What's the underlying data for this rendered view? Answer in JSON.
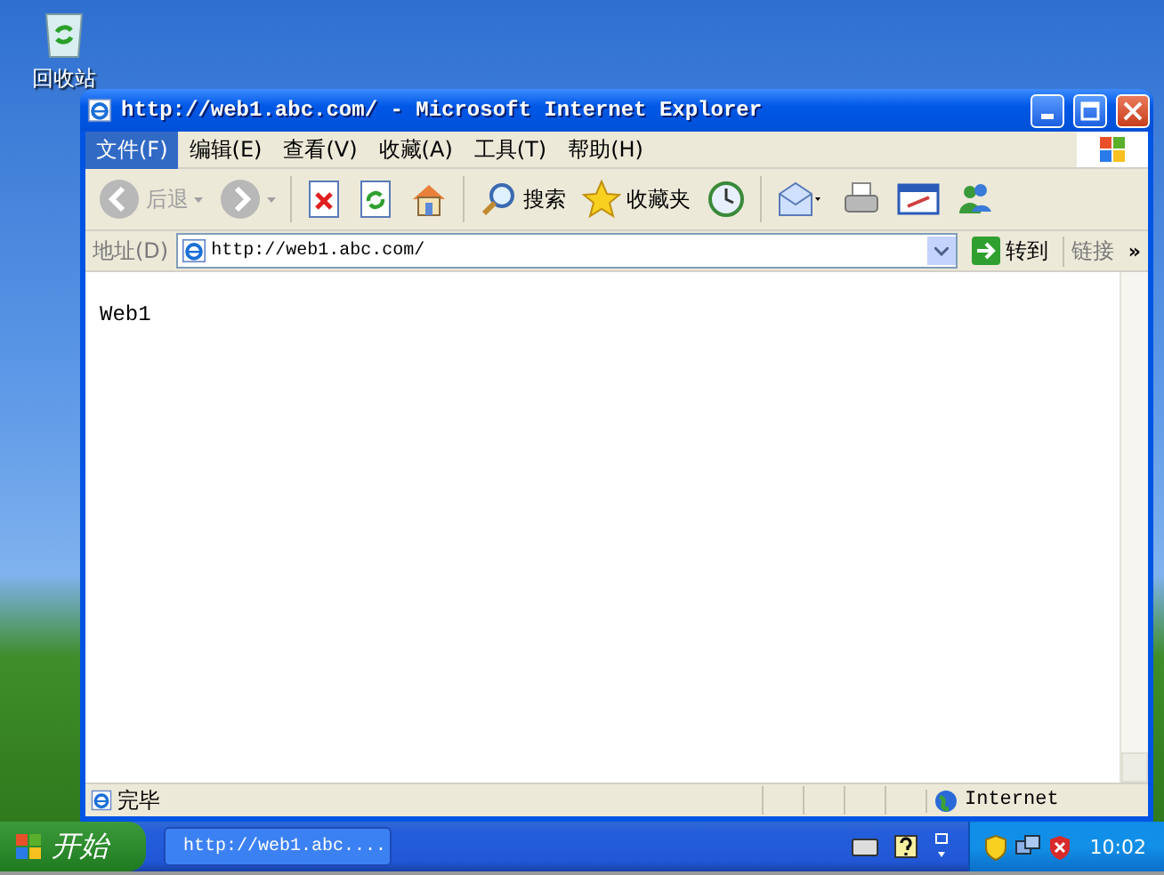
{
  "desktop_icons": [
    {
      "label": "回收站"
    }
  ],
  "window": {
    "title": "http://web1.abc.com/ - Microsoft Internet Explorer",
    "menu": [
      {
        "label": "文件(F)",
        "selected": true
      },
      {
        "label": "编辑(E)",
        "selected": false
      },
      {
        "label": "查看(V)",
        "selected": false
      },
      {
        "label": "收藏(A)",
        "selected": false
      },
      {
        "label": "工具(T)",
        "selected": false
      },
      {
        "label": "帮助(H)",
        "selected": false
      }
    ],
    "toolbar": [
      {
        "kind": "back",
        "label": "后退",
        "disabled": true
      },
      {
        "kind": "forward",
        "disabled": true
      },
      {
        "kind": "separator"
      },
      {
        "kind": "stop"
      },
      {
        "kind": "refresh"
      },
      {
        "kind": "home"
      },
      {
        "kind": "separator"
      },
      {
        "kind": "search",
        "label": "搜索"
      },
      {
        "kind": "favorites",
        "label": "收藏夹"
      },
      {
        "kind": "history"
      },
      {
        "kind": "separator"
      },
      {
        "kind": "mail"
      },
      {
        "kind": "print"
      },
      {
        "kind": "edit"
      },
      {
        "kind": "messenger"
      }
    ],
    "address": {
      "label": "地址(D)",
      "value": "http://web1.abc.com/",
      "go": "转到",
      "links": "链接",
      "more": "»"
    },
    "content": {
      "text": "Web1"
    },
    "status": {
      "text": "完毕",
      "zone": "Internet"
    }
  },
  "taskbar": {
    "start": "开始",
    "tasks": [
      {
        "label": "http://web1.abc....",
        "selected": false
      }
    ],
    "clock": "10:02"
  }
}
